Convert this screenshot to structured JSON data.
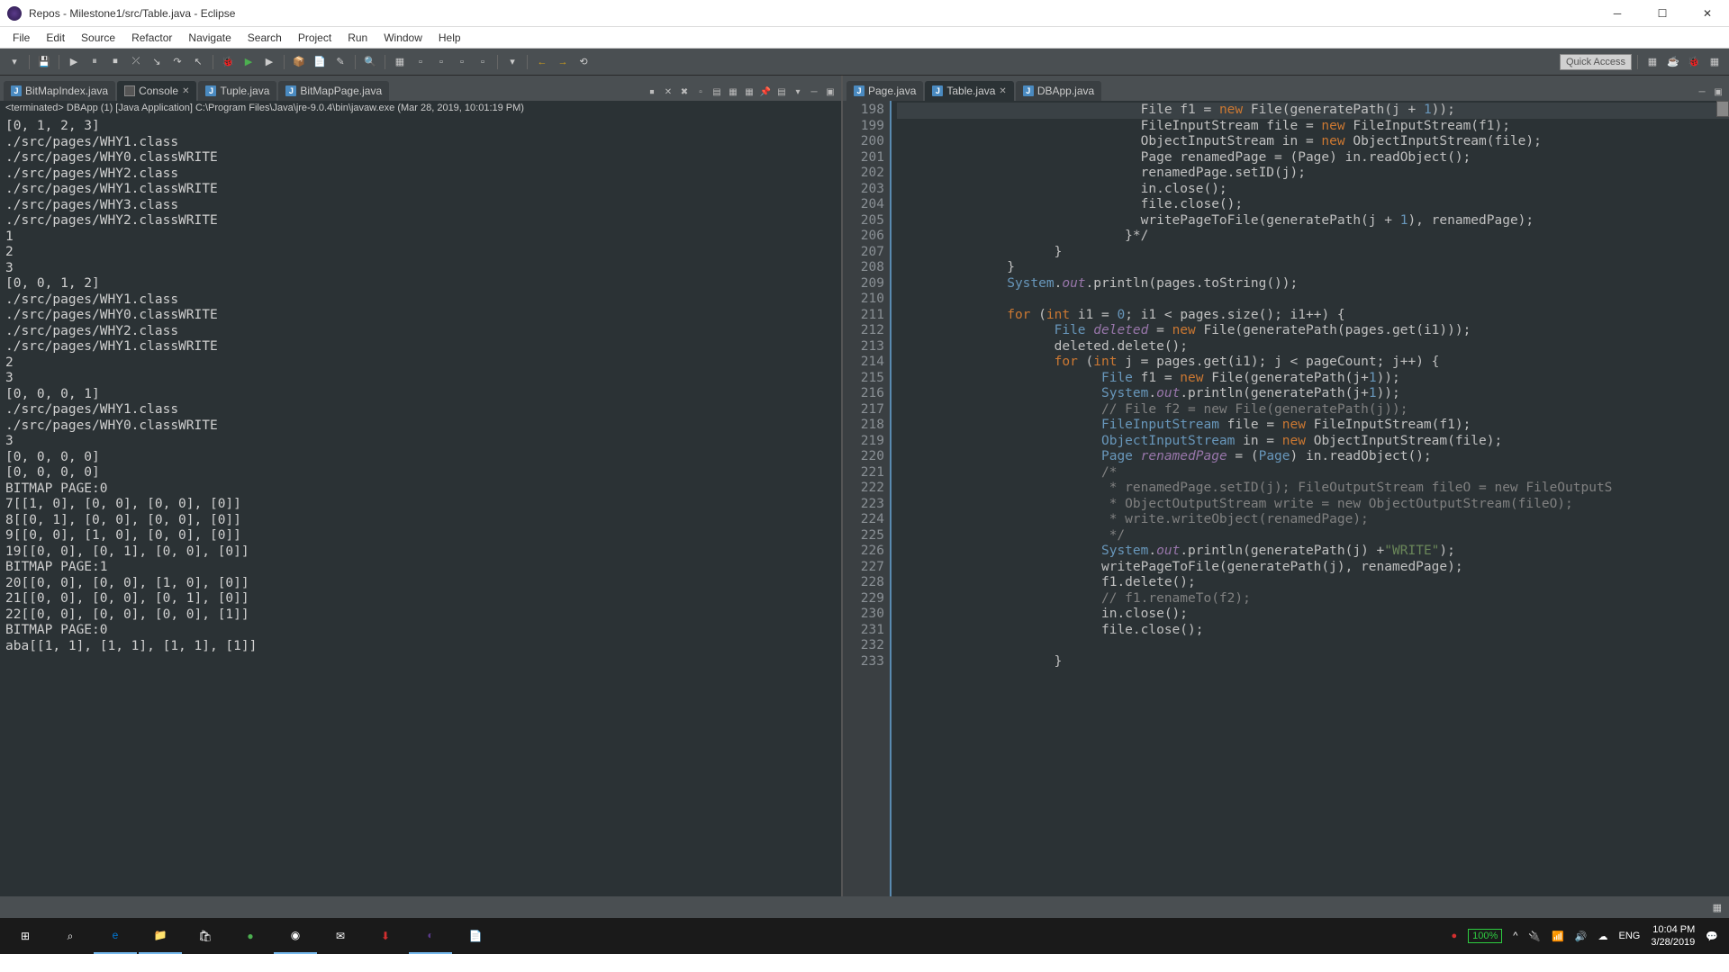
{
  "window": {
    "title": "Repos - Milestone1/src/Table.java - Eclipse"
  },
  "menu": [
    "File",
    "Edit",
    "Source",
    "Refactor",
    "Navigate",
    "Search",
    "Project",
    "Run",
    "Window",
    "Help"
  ],
  "quick_access": "Quick Access",
  "left": {
    "tabs": [
      {
        "label": "BitMapIndex.java",
        "icon": "java",
        "active": false,
        "close": false
      },
      {
        "label": "Console",
        "icon": "console",
        "active": true,
        "close": true
      },
      {
        "label": "Tuple.java",
        "icon": "java",
        "active": false,
        "close": false
      },
      {
        "label": "BitMapPage.java",
        "icon": "java",
        "active": false,
        "close": false
      }
    ],
    "console_header": "<terminated> DBApp (1) [Java Application] C:\\Program Files\\Java\\jre-9.0.4\\bin\\javaw.exe (Mar 28, 2019, 10:01:19 PM)",
    "console_lines": [
      "[0, 1, 2, 3]",
      "./src/pages/WHY1.class",
      "./src/pages/WHY0.classWRITE",
      "./src/pages/WHY2.class",
      "./src/pages/WHY1.classWRITE",
      "./src/pages/WHY3.class",
      "./src/pages/WHY2.classWRITE",
      "1",
      "2",
      "3",
      "[0, 0, 1, 2]",
      "./src/pages/WHY1.class",
      "./src/pages/WHY0.classWRITE",
      "./src/pages/WHY2.class",
      "./src/pages/WHY1.classWRITE",
      "2",
      "3",
      "[0, 0, 0, 1]",
      "./src/pages/WHY1.class",
      "./src/pages/WHY0.classWRITE",
      "3",
      "[0, 0, 0, 0]",
      "[0, 0, 0, 0]",
      "BITMAP PAGE:0",
      "7[[1, 0], [0, 0], [0, 0], [0]]",
      "8[[0, 1], [0, 0], [0, 0], [0]]",
      "9[[0, 0], [1, 0], [0, 0], [0]]",
      "19[[0, 0], [0, 1], [0, 0], [0]]",
      "BITMAP PAGE:1",
      "20[[0, 0], [0, 0], [1, 0], [0]]",
      "21[[0, 0], [0, 0], [0, 1], [0]]",
      "22[[0, 0], [0, 0], [0, 0], [1]]",
      "BITMAP PAGE:0",
      "aba[[1, 1], [1, 1], [1, 1], [1]]"
    ]
  },
  "right": {
    "tabs": [
      {
        "label": "Page.java",
        "icon": "java",
        "active": false,
        "close": false
      },
      {
        "label": "Table.java",
        "icon": "java",
        "active": true,
        "close": true
      },
      {
        "label": "DBApp.java",
        "icon": "java",
        "active": false,
        "close": false
      }
    ],
    "first_line": 198,
    "code": [
      {
        "hl": true,
        "tokens": [
          [
            "pl",
            "                               "
          ],
          [
            "pl",
            "File f1 = "
          ],
          [
            "kw",
            "new"
          ],
          [
            "pl",
            " File(generatePath(j + "
          ],
          [
            "num",
            "1"
          ],
          [
            "pl",
            "));"
          ]
        ]
      },
      {
        "tokens": [
          [
            "pl",
            "                               "
          ],
          [
            "pl",
            "FileInputStream file = "
          ],
          [
            "kw",
            "new"
          ],
          [
            "pl",
            " FileInputStream(f1);"
          ]
        ]
      },
      {
        "tokens": [
          [
            "pl",
            "                               "
          ],
          [
            "pl",
            "ObjectInputStream in = "
          ],
          [
            "kw",
            "new"
          ],
          [
            "pl",
            " ObjectInputStream(file);"
          ]
        ]
      },
      {
        "tokens": [
          [
            "pl",
            "                               "
          ],
          [
            "pl",
            "Page renamedPage = (Page) in.readObject();"
          ]
        ]
      },
      {
        "tokens": [
          [
            "pl",
            "                               "
          ],
          [
            "pl",
            "renamedPage.setID(j);"
          ]
        ]
      },
      {
        "tokens": [
          [
            "pl",
            "                               "
          ],
          [
            "pl",
            "in.close();"
          ]
        ]
      },
      {
        "tokens": [
          [
            "pl",
            "                               "
          ],
          [
            "pl",
            "file.close();"
          ]
        ]
      },
      {
        "tokens": [
          [
            "pl",
            "                               "
          ],
          [
            "pl",
            "writePageToFile(generatePath(j + "
          ],
          [
            "num",
            "1"
          ],
          [
            "pl",
            "), renamedPage);"
          ]
        ]
      },
      {
        "tokens": [
          [
            "pl",
            "                             "
          ],
          [
            "pl",
            "}*/"
          ]
        ]
      },
      {
        "tokens": [
          [
            "pl",
            "                    "
          ],
          [
            "pl",
            "}"
          ]
        ]
      },
      {
        "tokens": [
          [
            "pl",
            "              "
          ],
          [
            "pl",
            "}"
          ]
        ]
      },
      {
        "tokens": [
          [
            "pl",
            "              "
          ],
          [
            "typ",
            "System"
          ],
          [
            "pl",
            "."
          ],
          [
            "fld",
            "out"
          ],
          [
            "pl",
            ".println(pages.toString());"
          ]
        ]
      },
      {
        "tokens": [
          [
            "pl",
            ""
          ]
        ]
      },
      {
        "tokens": [
          [
            "pl",
            "              "
          ],
          [
            "kw",
            "for"
          ],
          [
            "pl",
            " ("
          ],
          [
            "kw",
            "int"
          ],
          [
            "pl",
            " i1 = "
          ],
          [
            "num",
            "0"
          ],
          [
            "pl",
            "; i1 < pages.size(); i1++) {"
          ]
        ]
      },
      {
        "tokens": [
          [
            "pl",
            "                    "
          ],
          [
            "typ",
            "File"
          ],
          [
            "pl",
            " "
          ],
          [
            "fld",
            "deleted"
          ],
          [
            "pl",
            " = "
          ],
          [
            "kw",
            "new"
          ],
          [
            "pl",
            " File(generatePath(pages.get(i1)));"
          ]
        ]
      },
      {
        "tokens": [
          [
            "pl",
            "                    "
          ],
          [
            "pl",
            "deleted.delete();"
          ]
        ]
      },
      {
        "tokens": [
          [
            "pl",
            "                    "
          ],
          [
            "kw",
            "for"
          ],
          [
            "pl",
            " ("
          ],
          [
            "kw",
            "int"
          ],
          [
            "pl",
            " j = pages.get(i1); j < pageCount; j++) {"
          ]
        ]
      },
      {
        "tokens": [
          [
            "pl",
            "                          "
          ],
          [
            "typ",
            "File"
          ],
          [
            "pl",
            " f1 = "
          ],
          [
            "kw",
            "new"
          ],
          [
            "pl",
            " File(generatePath(j+"
          ],
          [
            "num",
            "1"
          ],
          [
            "pl",
            "));"
          ]
        ]
      },
      {
        "tokens": [
          [
            "pl",
            "                          "
          ],
          [
            "typ",
            "System"
          ],
          [
            "pl",
            "."
          ],
          [
            "fld",
            "out"
          ],
          [
            "pl",
            ".println(generatePath(j+"
          ],
          [
            "num",
            "1"
          ],
          [
            "pl",
            "));"
          ]
        ]
      },
      {
        "tokens": [
          [
            "pl",
            "                          "
          ],
          [
            "cmt",
            "// File f2 = new File(generatePath(j));"
          ]
        ]
      },
      {
        "tokens": [
          [
            "pl",
            "                          "
          ],
          [
            "typ",
            "FileInputStream"
          ],
          [
            "pl",
            " file = "
          ],
          [
            "kw",
            "new"
          ],
          [
            "pl",
            " FileInputStream(f1);"
          ]
        ]
      },
      {
        "tokens": [
          [
            "pl",
            "                          "
          ],
          [
            "typ",
            "ObjectInputStream"
          ],
          [
            "pl",
            " in = "
          ],
          [
            "kw",
            "new"
          ],
          [
            "pl",
            " ObjectInputStream(file);"
          ]
        ]
      },
      {
        "tokens": [
          [
            "pl",
            "                          "
          ],
          [
            "typ",
            "Page"
          ],
          [
            "pl",
            " "
          ],
          [
            "fld",
            "renamedPage"
          ],
          [
            "pl",
            " = ("
          ],
          [
            "typ",
            "Page"
          ],
          [
            "pl",
            ") in.readObject();"
          ]
        ]
      },
      {
        "tokens": [
          [
            "pl",
            "                          "
          ],
          [
            "cmt",
            "/*"
          ]
        ]
      },
      {
        "tokens": [
          [
            "pl",
            "                           "
          ],
          [
            "cmt",
            "* renamedPage.setID(j); FileOutputStream fileO = new FileOutputS"
          ]
        ]
      },
      {
        "tokens": [
          [
            "pl",
            "                           "
          ],
          [
            "cmt",
            "* ObjectOutputStream write = new ObjectOutputStream(fileO);"
          ]
        ]
      },
      {
        "tokens": [
          [
            "pl",
            "                           "
          ],
          [
            "cmt",
            "* write.writeObject(renamedPage);"
          ]
        ]
      },
      {
        "tokens": [
          [
            "pl",
            "                           "
          ],
          [
            "cmt",
            "*/"
          ]
        ]
      },
      {
        "tokens": [
          [
            "pl",
            "                          "
          ],
          [
            "typ",
            "System"
          ],
          [
            "pl",
            "."
          ],
          [
            "fld",
            "out"
          ],
          [
            "pl",
            ".println(generatePath(j) +"
          ],
          [
            "str",
            "\"WRITE\""
          ],
          [
            "pl",
            ");"
          ]
        ]
      },
      {
        "tokens": [
          [
            "pl",
            "                          "
          ],
          [
            "pl",
            "writePageToFile(generatePath(j), renamedPage);"
          ]
        ]
      },
      {
        "tokens": [
          [
            "pl",
            "                          "
          ],
          [
            "pl",
            "f1.delete();"
          ]
        ]
      },
      {
        "tokens": [
          [
            "pl",
            "                          "
          ],
          [
            "cmt",
            "// f1.renameTo(f2);"
          ]
        ]
      },
      {
        "tokens": [
          [
            "pl",
            "                          "
          ],
          [
            "pl",
            "in.close();"
          ]
        ]
      },
      {
        "tokens": [
          [
            "pl",
            "                          "
          ],
          [
            "pl",
            "file.close();"
          ]
        ]
      },
      {
        "tokens": [
          [
            "pl",
            ""
          ]
        ]
      },
      {
        "tokens": [
          [
            "pl",
            "                    "
          ],
          [
            "pl",
            "}"
          ]
        ]
      }
    ]
  },
  "tray": {
    "battery": "100%",
    "lang": "ENG",
    "time": "10:04 PM",
    "date": "3/28/2019"
  }
}
